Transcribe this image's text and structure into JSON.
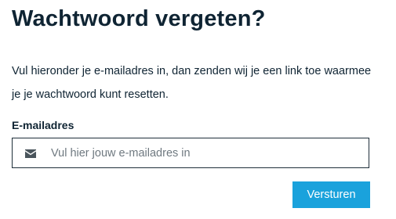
{
  "form": {
    "title": "Wachtwoord vergeten?",
    "intro": "Vul hieronder je e-mailadres in, dan zenden wij je een link toe waarmee je je wachtwoord kunt resetten.",
    "email_label": "E-mailadres",
    "email_placeholder": "Vul hier jouw e-mailadres in",
    "email_value": "",
    "email_icon": "envelope-icon",
    "submit_label": "Versturen"
  },
  "colors": {
    "text": "#0f2433",
    "button": "#1aa2dc",
    "button_text": "#ffffff",
    "placeholder": "#6f7980",
    "input_border": "#1f2f3a"
  }
}
